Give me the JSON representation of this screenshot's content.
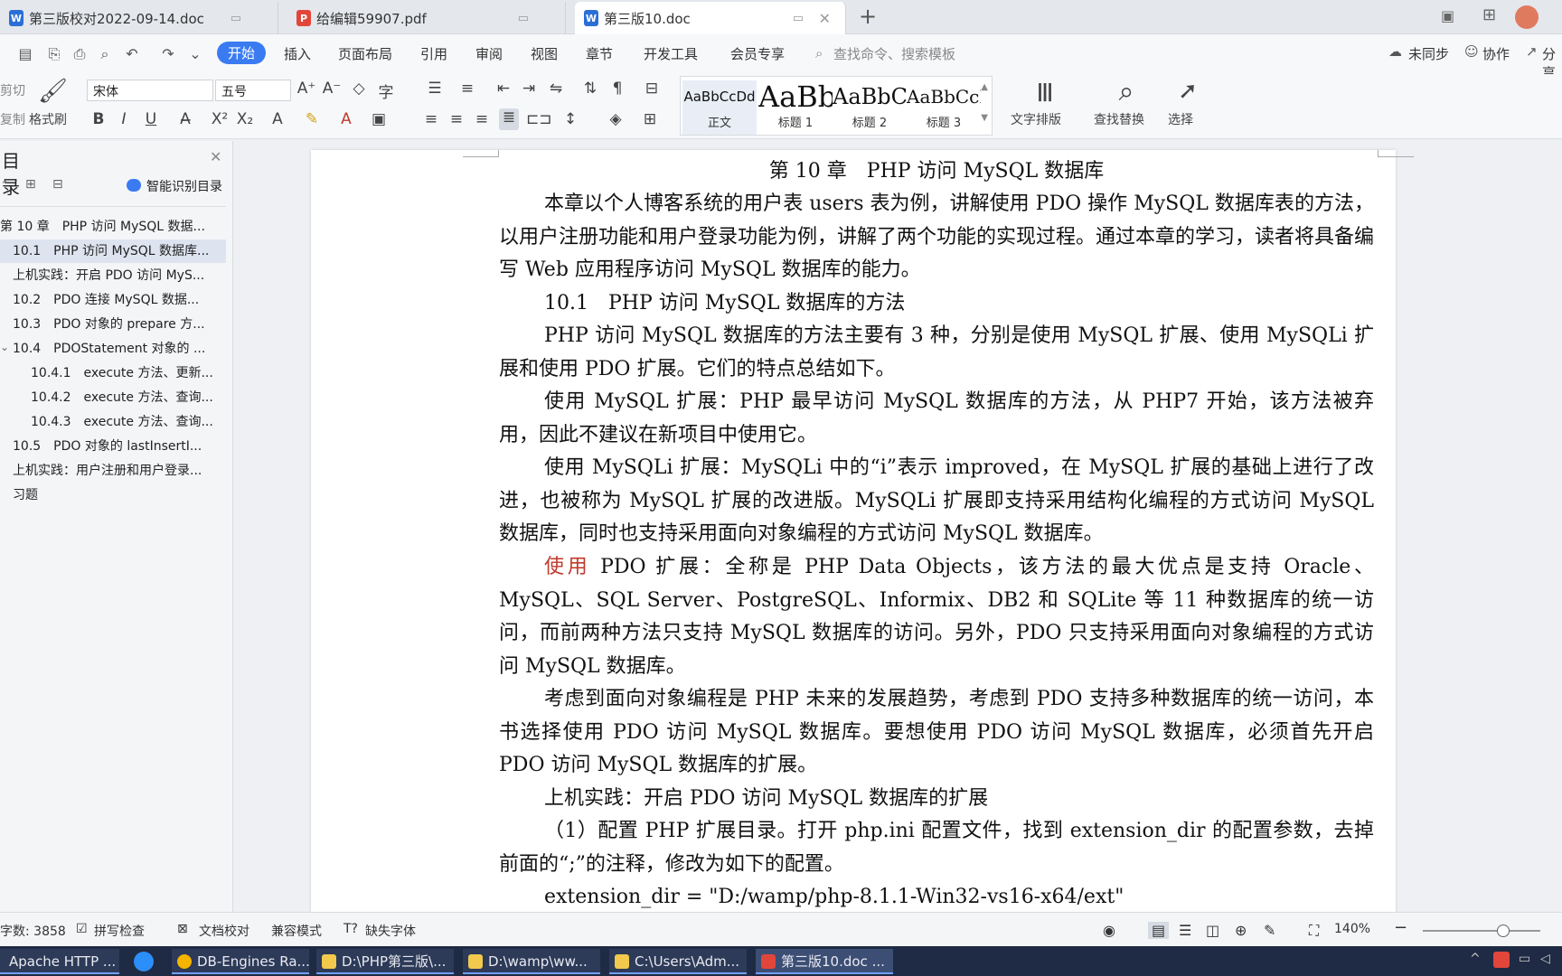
{
  "tabs": [
    {
      "title": "第三版校对2022-09-14.doc",
      "type": "word"
    },
    {
      "title": "给编辑59907.pdf",
      "type": "pdf"
    },
    {
      "title": "第三版10.doc",
      "type": "word"
    }
  ],
  "menu": [
    "开始",
    "插入",
    "页面布局",
    "引用",
    "审阅",
    "视图",
    "章节",
    "开发工具",
    "会员专享"
  ],
  "search_placeholder": "查找命令、搜索模板",
  "right_menu": {
    "sync": "未同步",
    "collab": "协作",
    "share": "分享"
  },
  "ribbon": {
    "cut": "剪切",
    "copy": "复制",
    "format_painter": "格式刷",
    "font_name": "宋体",
    "font_size": "五号",
    "styles": [
      {
        "sample": "AaBbCcDd",
        "name": "正文"
      },
      {
        "sample": "AaBb",
        "name": "标题 1"
      },
      {
        "sample": "AaBbC",
        "name": "标题 2"
      },
      {
        "sample": "AaBbCcD",
        "name": "标题 3"
      }
    ],
    "text_layout": "文字排版",
    "find_replace": "查找替换",
    "select": "选择"
  },
  "nav": {
    "title": "目录",
    "smart_toc": "智能识别目录",
    "items": [
      "第 10 章　PHP 访问 MySQL 数据...",
      "10.1　PHP 访问 MySQL 数据库...",
      "上机实践：开启 PDO 访问 MyS...",
      "10.2　PDO 连接 MySQL 数据...",
      "10.3　PDO 对象的 prepare 方...",
      "10.4　PDOStatement 对象的 ...",
      "10.4.1　execute 方法、更新...",
      "10.4.2　execute 方法、查询...",
      "10.4.3　execute 方法、查询...",
      "10.5　PDO 对象的 lastInsertI...",
      "上机实践：用户注册和用户登录...",
      "习题"
    ]
  },
  "document": {
    "chapter_title": "第 10 章　PHP 访问 MySQL 数据库",
    "p1": "本章以个人博客系统的用户表 users 表为例，讲解使用 PDO 操作 MySQL 数据库表的方法，以用户注册功能和用户登录功能为例，讲解了两个功能的实现过程。通过本章的学习，读者将具备编写 Web 应用程序访问 MySQL 数据库的能力。",
    "h_10_1": "10.1　PHP 访问 MySQL 数据库的方法",
    "p2": "PHP 访问 MySQL 数据库的方法主要有 3 种，分别是使用 MySQL 扩展、使用 MySQLi 扩展和使用 PDO 扩展。它们的特点总结如下。",
    "p3": "使用 MySQL 扩展：PHP 最早访问 MySQL 数据库的方法，从 PHP7 开始，该方法被弃用，因此不建议在新项目中使用它。",
    "p4": "使用 MySQLi 扩展：MySQLi 中的“i”表示 improved，在 MySQL 扩展的基础上进行了改进，也被称为 MySQL 扩展的改进版。MySQLi 扩展即支持采用结构化编程的方式访问 MySQL 数据库，同时也支持采用面向对象编程的方式访问 MySQL 数据库。",
    "p5_red": "使用",
    "p5": " PDO 扩展：全称是 PHP Data Objects，该方法的最大优点是支持 Oracle、MySQL、SQL Server、PostgreSQL、Informix、DB2 和 SQLite 等 11 种数据库的统一访问，而前两种方法只支持 MySQL 数据库的访问。另外，PDO 只支持采用面向对象编程的方式访问 MySQL 数据库。",
    "p6": "考虑到面向对象编程是 PHP 未来的发展趋势，考虑到 PDO 支持多种数据库的统一访问，本书选择使用 PDO 访问 MySQL 数据库。要想使用 PDO 访问 MySQL 数据库，必须首先开启 PDO 访问 MySQL 数据库的扩展。",
    "h_practice": "上机实践：开启 PDO 访问 MySQL 数据库的扩展",
    "p7": "（1）配置 PHP 扩展目录。打开 php.ini 配置文件，找到 extension_dir 的配置参数，去掉前面的“;”的注释，修改为如下的配置。",
    "p8": "extension_dir = \"D:/wamp/php-8.1.1-Win32-vs16-x64/ext\""
  },
  "status": {
    "word_count": "字数: 3858",
    "spell_check": "拼写检查",
    "doc_proof": "文档校对",
    "compat_mode": "兼容模式",
    "missing_font": "缺失字体",
    "zoom": "140%"
  },
  "taskbar": [
    "Apache HTTP ...",
    "DB-Engines Ra...",
    "D:\\PHP第三版\\...",
    "D:\\wamp\\ww...",
    "C:\\Users\\Adm...",
    "第三版10.doc ..."
  ],
  "colors": {
    "accent": "#3a7bf2",
    "taskbar": "#1f2a44",
    "red_text": "#c0392b"
  }
}
